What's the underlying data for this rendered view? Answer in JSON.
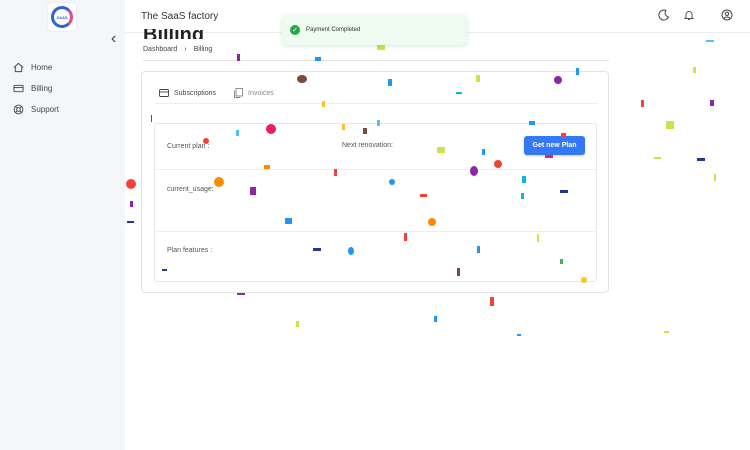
{
  "app": {
    "title": "The SaaS factory",
    "logo_text": "SAAS"
  },
  "sidebar": {
    "collapse_icon": "chevron-left-icon",
    "items": [
      {
        "label": "Home",
        "icon": "home-icon"
      },
      {
        "label": "Billing",
        "icon": "credit-card-icon"
      },
      {
        "label": "Support",
        "icon": "lifebuoy-icon"
      }
    ]
  },
  "header": {
    "icons": [
      "moon-icon",
      "bell-icon",
      "user-circle-icon"
    ]
  },
  "toast": {
    "message": "Payment Completed",
    "status_color": "#28a745"
  },
  "page": {
    "title": "Billing",
    "breadcrumb": [
      "Dashboard",
      "Billing"
    ]
  },
  "tabs": [
    {
      "label": "Subscriptions",
      "active": true
    },
    {
      "label": "Invoices",
      "active": false
    }
  ],
  "subscription": {
    "current_plan_label": "Current plan :",
    "next_renovation_label": "Next renovation:",
    "current_usage_label": "current_usage:",
    "plan_features_label": "Plan features :",
    "new_plan_button": "Get new Plan"
  },
  "colors": {
    "accent": "#3478f6",
    "sidebar_bg": "#f4f6f9"
  }
}
